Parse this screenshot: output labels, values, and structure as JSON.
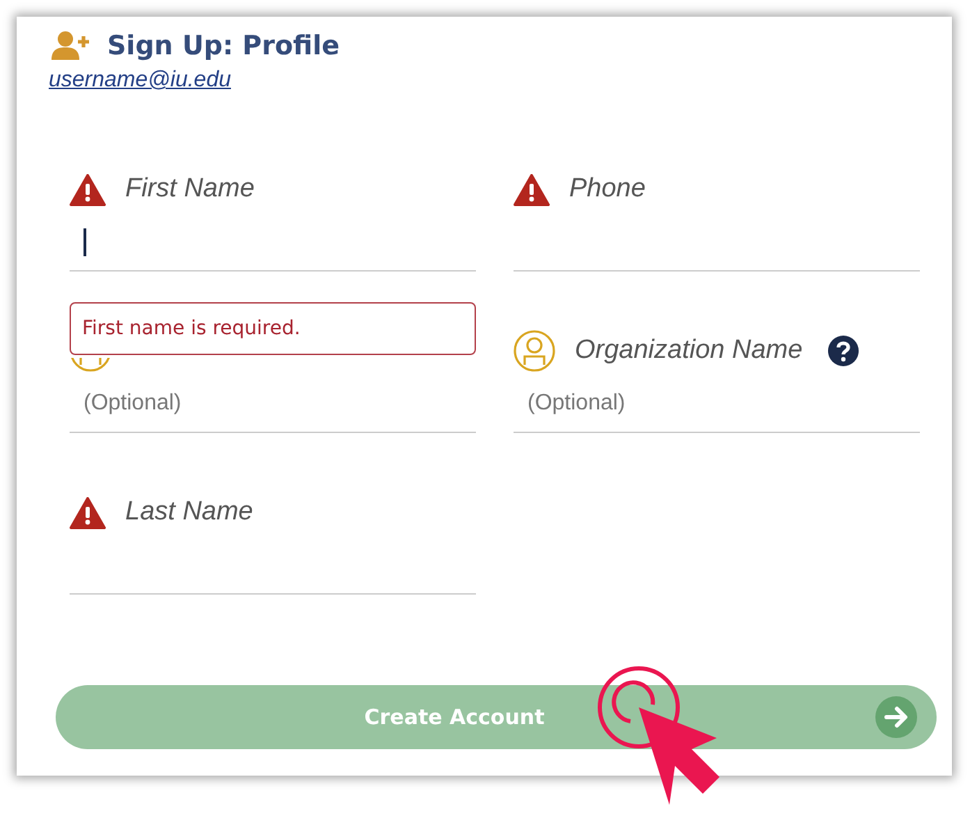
{
  "header": {
    "title": "Sign Up: Profile",
    "email": "username@iu.edu"
  },
  "fields": [
    {
      "kind": "required",
      "label": "First Name",
      "focused": true,
      "help": false,
      "error": "First name is required."
    },
    {
      "kind": "required",
      "label": "Phone",
      "focused": false,
      "help": false
    },
    {
      "kind": "optional",
      "placeholder": "(Optional)",
      "focused": false,
      "help": false
    },
    {
      "kind": "optional",
      "label": "Organization Name",
      "placeholder": "(Optional)",
      "focused": false,
      "help": true
    },
    {
      "kind": "required",
      "label": "Last Name",
      "focused": false,
      "help": false
    }
  ],
  "submit": {
    "label": "Create Account"
  }
}
